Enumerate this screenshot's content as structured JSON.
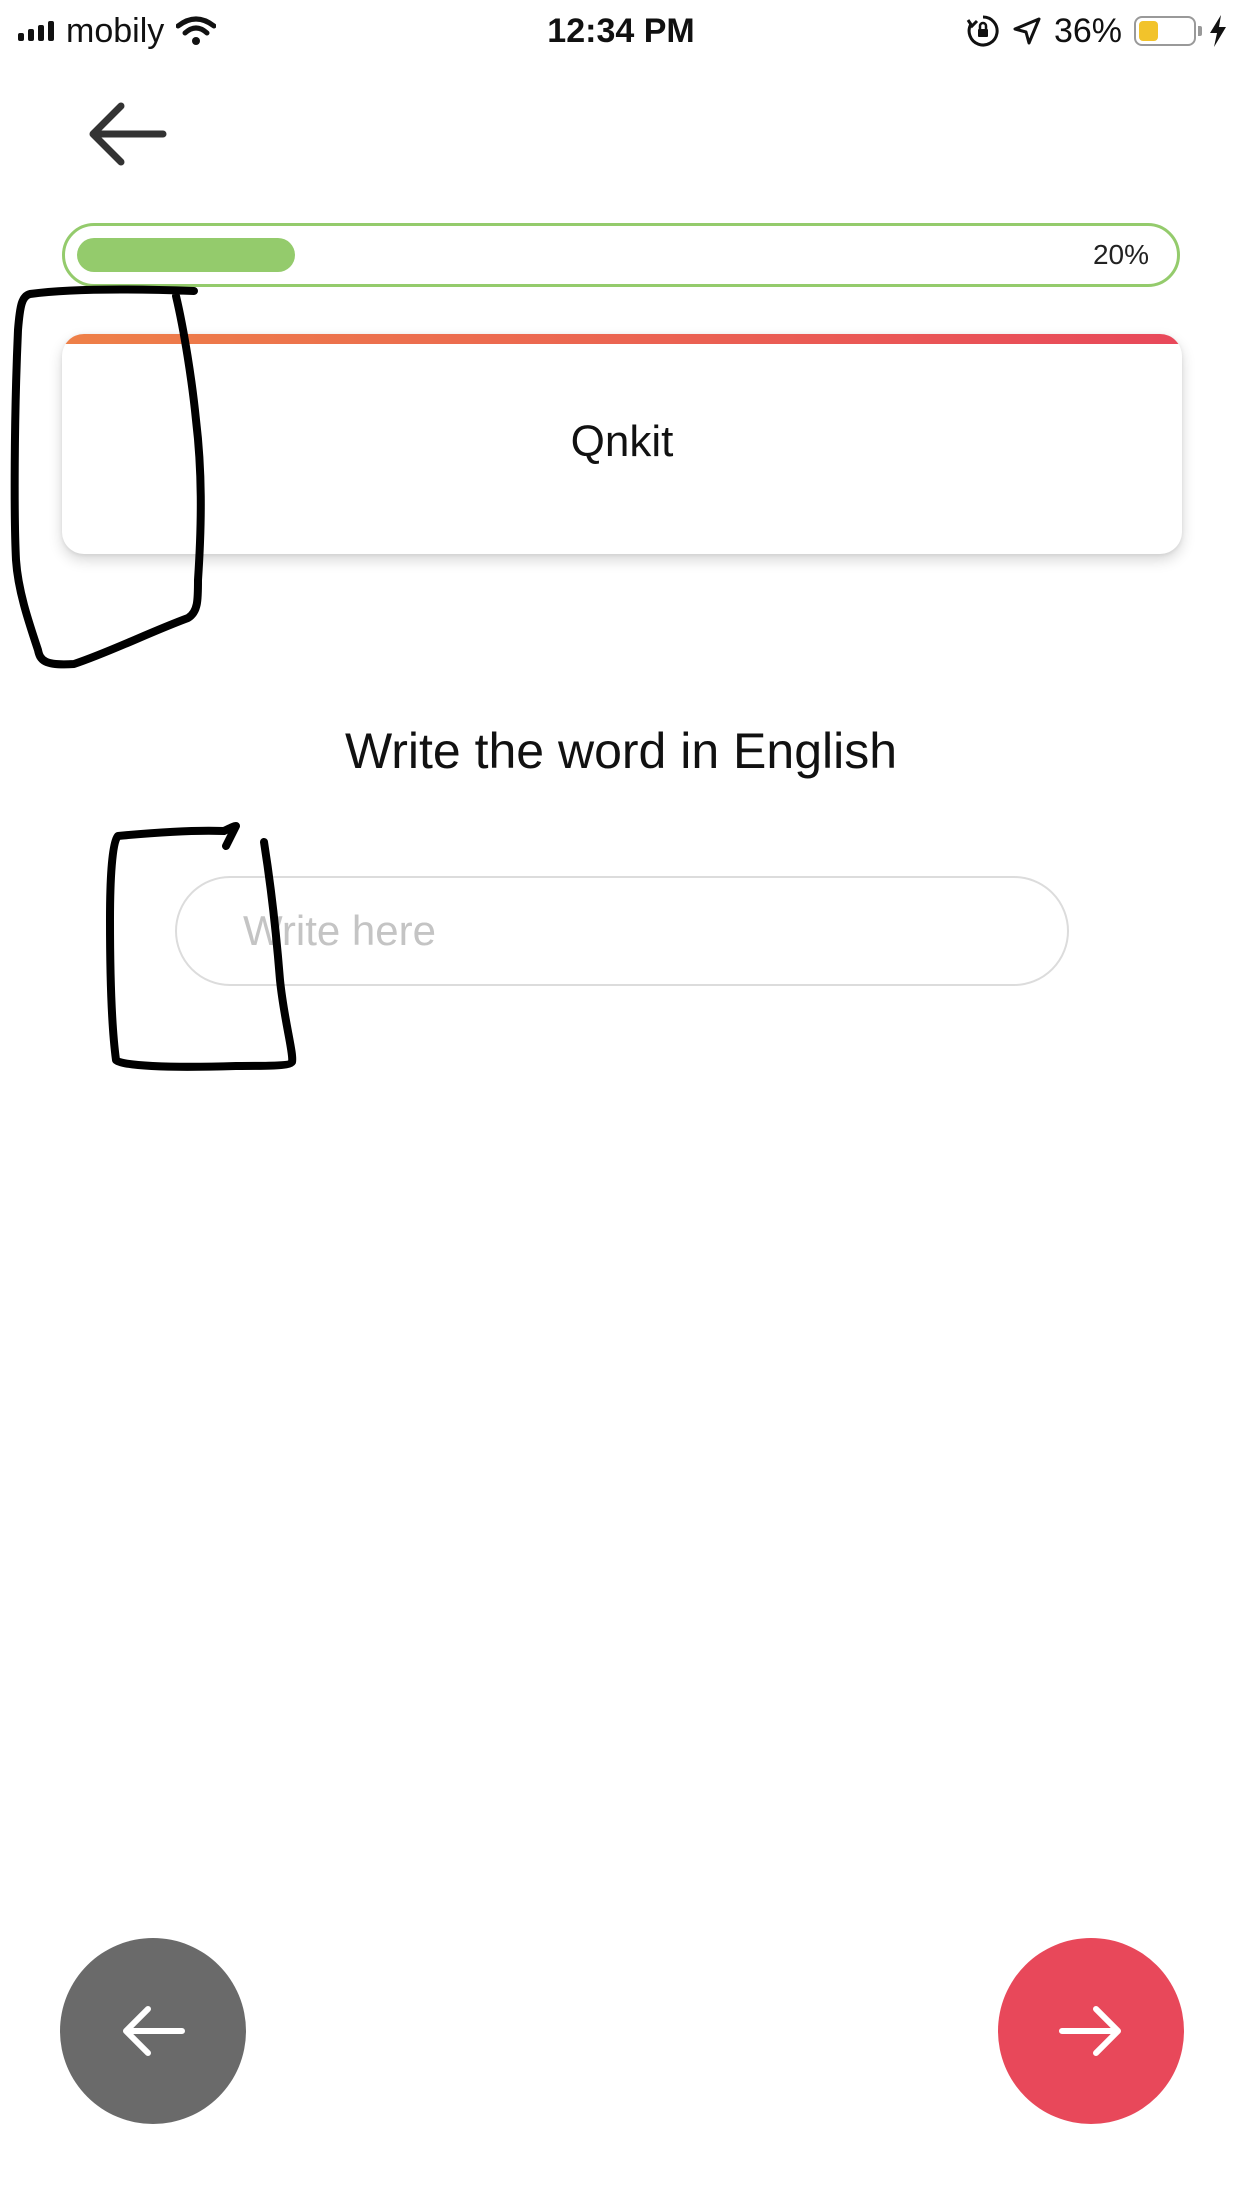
{
  "status_bar": {
    "carrier": "mobily",
    "time": "12:34 PM",
    "battery_percent": "36%",
    "battery_level": 0.36,
    "battery_color": "#f2c32b"
  },
  "progress": {
    "label": "20%",
    "value": 0.2,
    "color": "#94cb6c"
  },
  "card": {
    "word": "Qnkit",
    "stripe_colors": [
      "#ee8048",
      "#e8485a"
    ]
  },
  "instruction": "Write the word in English",
  "answer": {
    "placeholder": "Write here",
    "value": ""
  },
  "nav": {
    "prev_icon": "arrow-left-icon",
    "next_icon": "arrow-right-icon",
    "prev_color": "#6a6a6a",
    "next_color": "#e8485a"
  },
  "icons": {
    "back": "back-arrow-icon",
    "signal": "cellular-signal-icon",
    "wifi": "wifi-icon",
    "orientation_lock": "orientation-lock-icon",
    "location": "location-icon",
    "battery": "battery-icon",
    "charging": "charging-bolt-icon"
  }
}
